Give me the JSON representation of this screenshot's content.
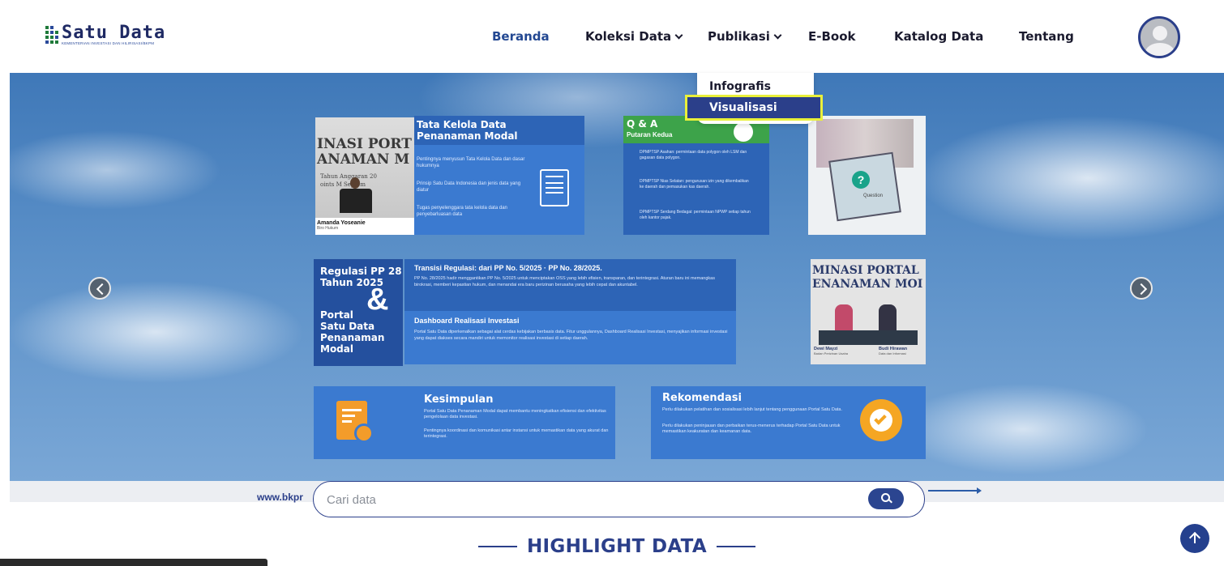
{
  "header": {
    "logo_title": "Satu Data",
    "logo_subtitle": "KEMENTERIAN INVESTASI DAN HILIRISASI/BKPM",
    "nav": [
      {
        "label": "Beranda",
        "active": true
      },
      {
        "label": "Koleksi Data",
        "has_dropdown": true
      },
      {
        "label": "Publikasi",
        "has_dropdown": true
      },
      {
        "label": "E-Book"
      },
      {
        "label": "Katalog Data"
      },
      {
        "label": "Tentang"
      }
    ],
    "avatar_icon": "user-avatar-icon"
  },
  "dropdown": {
    "items": [
      "Infografis",
      "Visualisasi"
    ],
    "selected": "Visualisasi"
  },
  "hero": {
    "slide": {
      "tata_kelola": {
        "title": "Tata Kelola Data Penanaman Modal",
        "points": [
          "Pentingnya menyusun Tata Kelola Data dan dasar hukumnya",
          "Prinsip Satu Data Indonesia dan jenis data yang diatur",
          "Tugas penyelenggara tata kelola data dan penyebarluasan data"
        ]
      },
      "photo1": {
        "banner_line1": "INASI PORT",
        "banner_line2": "ANAMAN M",
        "banner_line3": "Tahun Anggaran 20",
        "banner_line4": "oints M Septem",
        "caption_name": "Amanda Yoseanie",
        "caption_role": "Biro Hukum"
      },
      "qa": {
        "title": "Q & A",
        "subtitle": "Putaran Kedua",
        "points": [
          "DPMPTSP Asahan: permintaan data polygon oleh LSM dan gagasan data polygon.",
          "DPMPTSP Nias Selatan: pengurusan izin yang dikembalikan ke daerah dan pemasukan kas daerah.",
          "DPMPTSP Serdang Bedagai: permintaan NPWP setiap tahun oleh kantor pajak."
        ]
      },
      "photo2": {
        "card_text": "Question"
      },
      "regulasi": {
        "left_line1": "Regulasi PP 28",
        "left_line2": "Tahun 2025",
        "ampersand": "&",
        "left_line3": "Portal",
        "left_line4": "Satu Data",
        "left_line5": "Penanaman",
        "left_line6": "Modal",
        "transisi_title": "Transisi Regulasi: dari PP No. 5/2025 · PP No. 28/2025.",
        "transisi_text": "PP No. 28/2025 hadir menggantikan PP No. 5/2025 untuk menciptakan OSS yang lebih efisien, transparan, dan terintegrasi. Aturan baru ini memangkas birokrasi, memberi kepastian hukum, dan menandai era baru perizinan berusaha yang lebih cepat dan akuntabel.",
        "dashboard_title": "Dashboard Realisasi Investasi",
        "dashboard_text": "Portal Satu Data diperkenalkan sebagai alat cerdas kebijakan berbasis data. Fitur unggulannya, Dashboard Realisasi Investasi, menyajikan informasi investasi yang dapat diakses secara mandiri untuk memonitor realisasi investasi di setiap daerah."
      },
      "photo3": {
        "banner_line1": "MINASI PORTAL",
        "banner_line2": "ENANAMAN MOI",
        "caption_left_name": "Dewi Mayzi",
        "caption_left_role": "Badan Perizinan Usaha",
        "caption_right_name": "Budi Hirawan",
        "caption_right_role": "Data dan Informasi"
      },
      "kesimpulan": {
        "title": "Kesimpulan",
        "text1": "Portal Satu Data Penanaman Modal dapat membantu meningkatkan efisiensi dan efektivitas pengelolaan data investasi.",
        "text2": "Pentingnya koordinasi dan komunikasi antar instansi untuk memastikan data yang akurat dan terintegrasi."
      },
      "rekomendasi": {
        "title": "Rekomendasi",
        "text1": "Perlu dilakukan pelatihan dan sosialisasi lebih lanjut tentang penggunaan Portal Satu Data.",
        "text2": "Perlu dilakukan peninjauan dan perbaikan terus-menerus terhadap Portal Satu Data untuk memastikan keakuratan dan keamanan data."
      }
    },
    "strip_url": "www.bkpr"
  },
  "search": {
    "placeholder": "Cari data",
    "value": ""
  },
  "highlight": {
    "title": "HIGHLIGHT DATA"
  },
  "colors": {
    "brand": "#2b3f8a",
    "accent_yellow": "#e9f03a",
    "panel_blue": "#2d64b6",
    "orange": "#f39c2a"
  }
}
